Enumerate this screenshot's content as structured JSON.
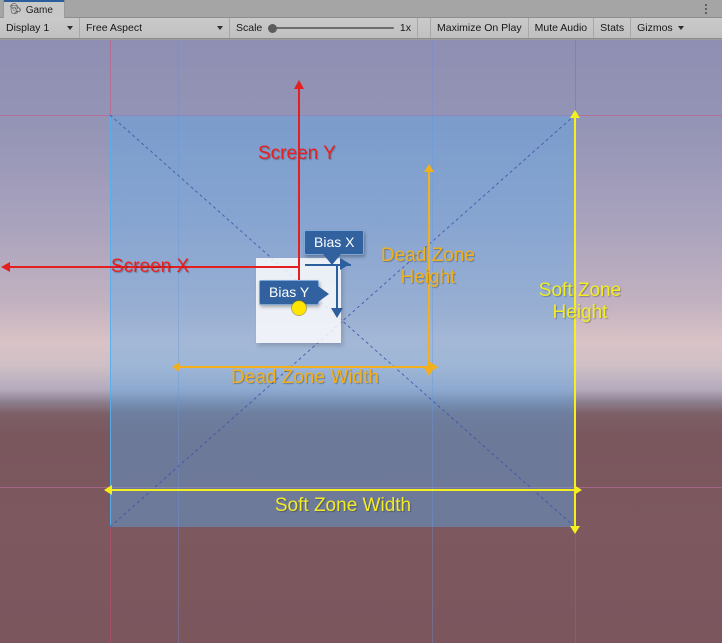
{
  "window": {
    "tab_label": "Game",
    "tab_icon": "game-controller-icon",
    "menu_icon": "kebab-menu-icon"
  },
  "toolbar": {
    "display_label": "Display 1",
    "aspect_label": "Free Aspect",
    "scale_label": "Scale",
    "scale_value": "1x",
    "maximize_label": "Maximize On Play",
    "mute_label": "Mute Audio",
    "stats_label": "Stats",
    "gizmos_label": "Gizmos",
    "dropdown_icon": "chevron-down-icon"
  },
  "gizmo": {
    "screen_x_label": "Screen X",
    "screen_y_label": "Screen Y",
    "dead_zone_width_label": "Dead Zone Width",
    "dead_zone_height_label": "Dead Zone\nHeight",
    "dead_zone_height_line1": "Dead Zone",
    "dead_zone_height_line2": "Height",
    "soft_zone_width_label": "Soft Zone Width",
    "soft_zone_height_line1": "Soft Zone",
    "soft_zone_height_line2": "Height",
    "bias_x_label": "Bias X",
    "bias_y_label": "Bias Y",
    "colors": {
      "screen_axis": "#e41f1f",
      "dead_zone": "#f2b01c",
      "soft_zone": "#f5ef20",
      "soft_zone_fill": "rgba(90,170,235,0.42)",
      "bias_callout": "#31619e",
      "target_dot": "#ffe500",
      "guide_grid": "rgba(220,70,110,0.45)"
    }
  }
}
